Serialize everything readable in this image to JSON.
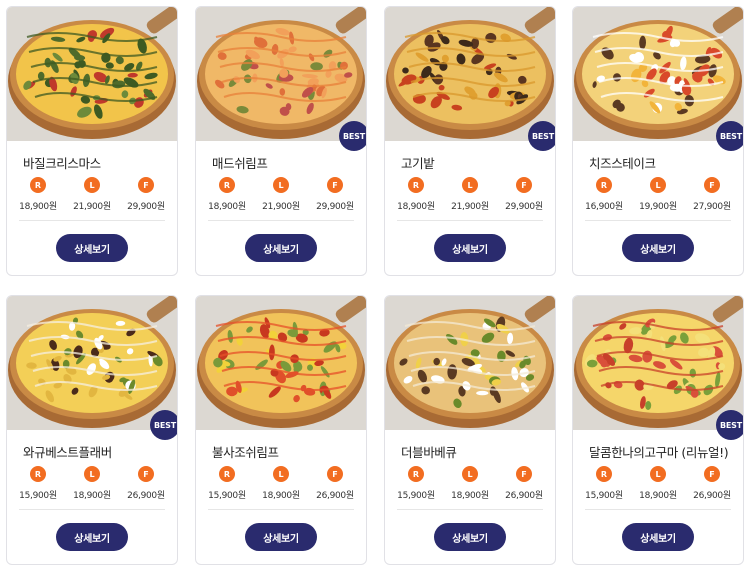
{
  "size_labels": [
    "R",
    "L",
    "F"
  ],
  "best_label": "BEST",
  "detail_label": "상세보기",
  "colors": {
    "accent_orange": "#f26d21",
    "navy": "#2a2b6e"
  },
  "products": [
    {
      "name": "바질크리스마스",
      "best": false,
      "prices": [
        "18,900원",
        "21,900원",
        "29,900원"
      ],
      "topping_style": "basil"
    },
    {
      "name": "매드쉬림프",
      "best": true,
      "prices": [
        "18,900원",
        "21,900원",
        "29,900원"
      ],
      "topping_style": "shrimp"
    },
    {
      "name": "고기밭",
      "best": true,
      "prices": [
        "18,900원",
        "21,900원",
        "29,900원"
      ],
      "topping_style": "meat"
    },
    {
      "name": "치즈스테이크",
      "best": true,
      "prices": [
        "16,900원",
        "19,900원",
        "27,900원"
      ],
      "topping_style": "steak"
    },
    {
      "name": "와규베스트플래버",
      "best": true,
      "prices": [
        "15,900원",
        "18,900원",
        "26,900원"
      ],
      "topping_style": "wagyu"
    },
    {
      "name": "불사조쉬림프",
      "best": false,
      "prices": [
        "15,900원",
        "18,900원",
        "26,900원"
      ],
      "topping_style": "phoenix"
    },
    {
      "name": "더블바베큐",
      "best": false,
      "prices": [
        "15,900원",
        "18,900원",
        "26,900원"
      ],
      "topping_style": "bbq"
    },
    {
      "name": "달콤한나의고구마 (리뉴얼!)",
      "best": true,
      "prices": [
        "15,900원",
        "18,900원",
        "26,900원"
      ],
      "topping_style": "sweetpotato"
    }
  ]
}
